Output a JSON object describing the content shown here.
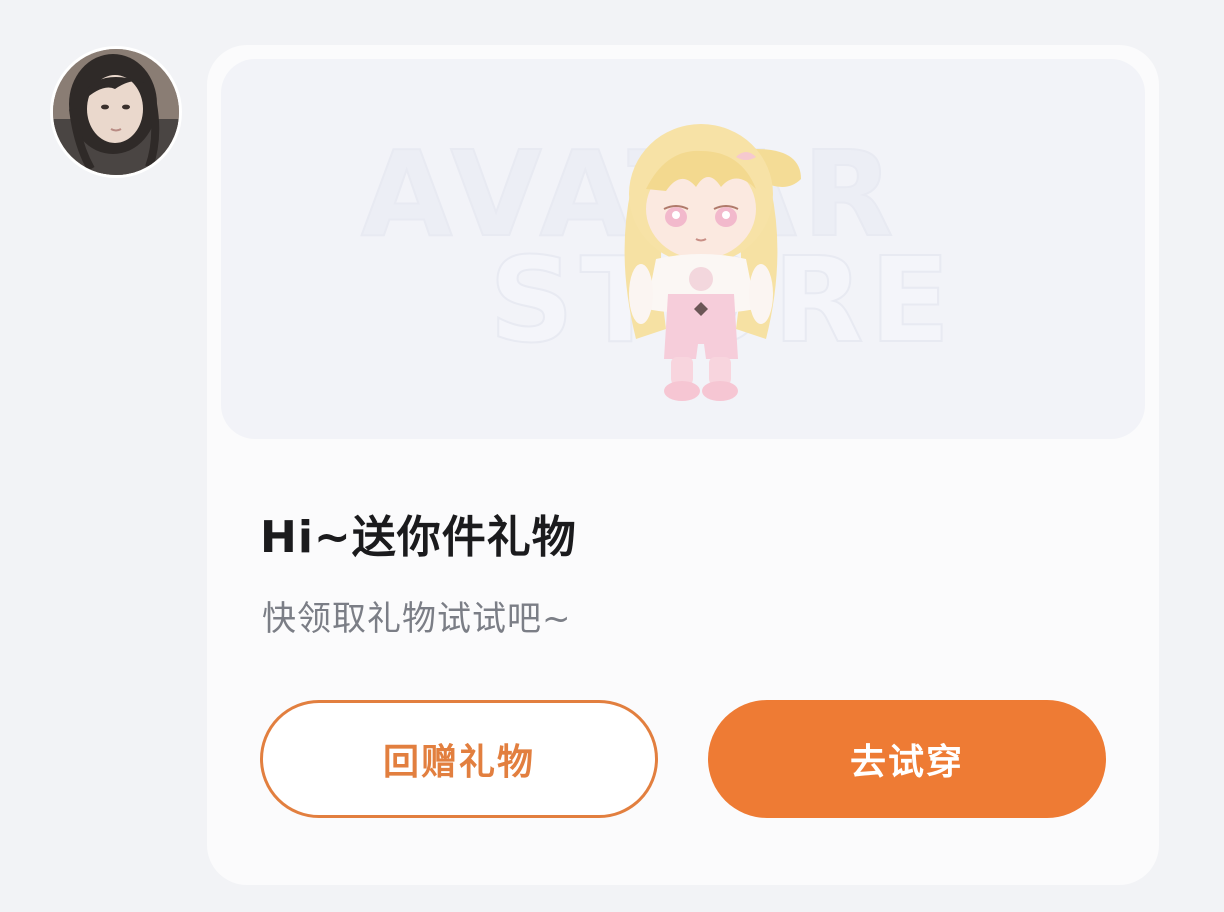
{
  "colors": {
    "background": "#f2f3f6",
    "card": "#fbfbfc",
    "accent": "#ee7b34",
    "title_text": "#1b1b1d",
    "subtitle_text": "#7b7e86"
  },
  "sender": {
    "avatar_icon": "user-avatar-photo"
  },
  "gift_card": {
    "preview": {
      "watermark_line1": "AVATAR",
      "watermark_line2": "STORE",
      "item_icon": "chibi-avatar-outfit"
    },
    "title": "Hi~送你件礼物",
    "subtitle": "快领取礼物试试吧~",
    "buttons": {
      "return_gift": "回赠礼物",
      "try_on": "去试穿"
    }
  }
}
